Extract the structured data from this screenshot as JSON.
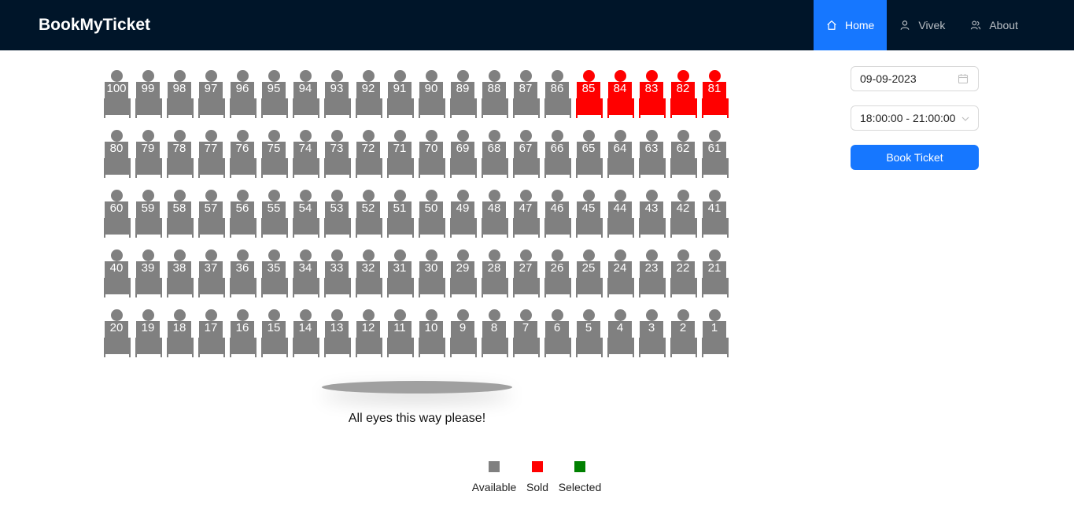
{
  "app": {
    "title": "BookMyTicket"
  },
  "nav": {
    "items": [
      {
        "label": "Home",
        "icon": "home-icon",
        "active": true
      },
      {
        "label": "Vivek",
        "icon": "user-icon",
        "active": false
      },
      {
        "label": "About",
        "icon": "team-icon",
        "active": false
      }
    ]
  },
  "colors": {
    "available": "#808080",
    "sold": "#ff0000",
    "selected": "#008000",
    "accent": "#1677ff",
    "navbar": "#001529"
  },
  "seat_rows": [
    {
      "seats": [
        {
          "number": "100",
          "status": "available"
        },
        {
          "number": "99",
          "status": "available"
        },
        {
          "number": "98",
          "status": "available"
        },
        {
          "number": "97",
          "status": "available"
        },
        {
          "number": "96",
          "status": "available"
        },
        {
          "number": "95",
          "status": "available"
        },
        {
          "number": "94",
          "status": "available"
        },
        {
          "number": "93",
          "status": "available"
        },
        {
          "number": "92",
          "status": "available"
        },
        {
          "number": "91",
          "status": "available"
        },
        {
          "number": "90",
          "status": "available"
        },
        {
          "number": "89",
          "status": "available"
        },
        {
          "number": "88",
          "status": "available"
        },
        {
          "number": "87",
          "status": "available"
        },
        {
          "number": "86",
          "status": "available"
        },
        {
          "number": "85",
          "status": "sold"
        },
        {
          "number": "84",
          "status": "sold"
        },
        {
          "number": "83",
          "status": "sold"
        },
        {
          "number": "82",
          "status": "sold"
        },
        {
          "number": "81",
          "status": "sold"
        }
      ]
    },
    {
      "seats": [
        {
          "number": "80",
          "status": "available"
        },
        {
          "number": "79",
          "status": "available"
        },
        {
          "number": "78",
          "status": "available"
        },
        {
          "number": "77",
          "status": "available"
        },
        {
          "number": "76",
          "status": "available"
        },
        {
          "number": "75",
          "status": "available"
        },
        {
          "number": "74",
          "status": "available"
        },
        {
          "number": "73",
          "status": "available"
        },
        {
          "number": "72",
          "status": "available"
        },
        {
          "number": "71",
          "status": "available"
        },
        {
          "number": "70",
          "status": "available"
        },
        {
          "number": "69",
          "status": "available"
        },
        {
          "number": "68",
          "status": "available"
        },
        {
          "number": "67",
          "status": "available"
        },
        {
          "number": "66",
          "status": "available"
        },
        {
          "number": "65",
          "status": "available"
        },
        {
          "number": "64",
          "status": "available"
        },
        {
          "number": "63",
          "status": "available"
        },
        {
          "number": "62",
          "status": "available"
        },
        {
          "number": "61",
          "status": "available"
        }
      ]
    },
    {
      "seats": [
        {
          "number": "60",
          "status": "available"
        },
        {
          "number": "59",
          "status": "available"
        },
        {
          "number": "58",
          "status": "available"
        },
        {
          "number": "57",
          "status": "available"
        },
        {
          "number": "56",
          "status": "available"
        },
        {
          "number": "55",
          "status": "available"
        },
        {
          "number": "54",
          "status": "available"
        },
        {
          "number": "53",
          "status": "available"
        },
        {
          "number": "52",
          "status": "available"
        },
        {
          "number": "51",
          "status": "available"
        },
        {
          "number": "50",
          "status": "available"
        },
        {
          "number": "49",
          "status": "available"
        },
        {
          "number": "48",
          "status": "available"
        },
        {
          "number": "47",
          "status": "available"
        },
        {
          "number": "46",
          "status": "available"
        },
        {
          "number": "45",
          "status": "available"
        },
        {
          "number": "44",
          "status": "available"
        },
        {
          "number": "43",
          "status": "available"
        },
        {
          "number": "42",
          "status": "available"
        },
        {
          "number": "41",
          "status": "available"
        }
      ]
    },
    {
      "seats": [
        {
          "number": "40",
          "status": "available"
        },
        {
          "number": "39",
          "status": "available"
        },
        {
          "number": "38",
          "status": "available"
        },
        {
          "number": "37",
          "status": "available"
        },
        {
          "number": "36",
          "status": "available"
        },
        {
          "number": "35",
          "status": "available"
        },
        {
          "number": "34",
          "status": "available"
        },
        {
          "number": "33",
          "status": "available"
        },
        {
          "number": "32",
          "status": "available"
        },
        {
          "number": "31",
          "status": "available"
        },
        {
          "number": "30",
          "status": "available"
        },
        {
          "number": "29",
          "status": "available"
        },
        {
          "number": "28",
          "status": "available"
        },
        {
          "number": "27",
          "status": "available"
        },
        {
          "number": "26",
          "status": "available"
        },
        {
          "number": "25",
          "status": "available"
        },
        {
          "number": "24",
          "status": "available"
        },
        {
          "number": "23",
          "status": "available"
        },
        {
          "number": "22",
          "status": "available"
        },
        {
          "number": "21",
          "status": "available"
        }
      ]
    },
    {
      "seats": [
        {
          "number": "20",
          "status": "available"
        },
        {
          "number": "19",
          "status": "available"
        },
        {
          "number": "18",
          "status": "available"
        },
        {
          "number": "17",
          "status": "available"
        },
        {
          "number": "16",
          "status": "available"
        },
        {
          "number": "15",
          "status": "available"
        },
        {
          "number": "14",
          "status": "available"
        },
        {
          "number": "13",
          "status": "available"
        },
        {
          "number": "12",
          "status": "available"
        },
        {
          "number": "11",
          "status": "available"
        },
        {
          "number": "10",
          "status": "available"
        },
        {
          "number": "9",
          "status": "available"
        },
        {
          "number": "8",
          "status": "available"
        },
        {
          "number": "7",
          "status": "available"
        },
        {
          "number": "6",
          "status": "available"
        },
        {
          "number": "5",
          "status": "available"
        },
        {
          "number": "4",
          "status": "available"
        },
        {
          "number": "3",
          "status": "available"
        },
        {
          "number": "2",
          "status": "available"
        },
        {
          "number": "1",
          "status": "available"
        }
      ]
    }
  ],
  "screen": {
    "caption": "All eyes this way please!"
  },
  "legend": {
    "available": "Available",
    "sold": "Sold",
    "selected": "Selected"
  },
  "booking": {
    "date": "09-09-2023",
    "date_icon": "calendar-icon",
    "time_slot": "18:00:00 - 21:00:00",
    "time_icon": "chevron-down-icon",
    "book_label": "Book Ticket"
  }
}
